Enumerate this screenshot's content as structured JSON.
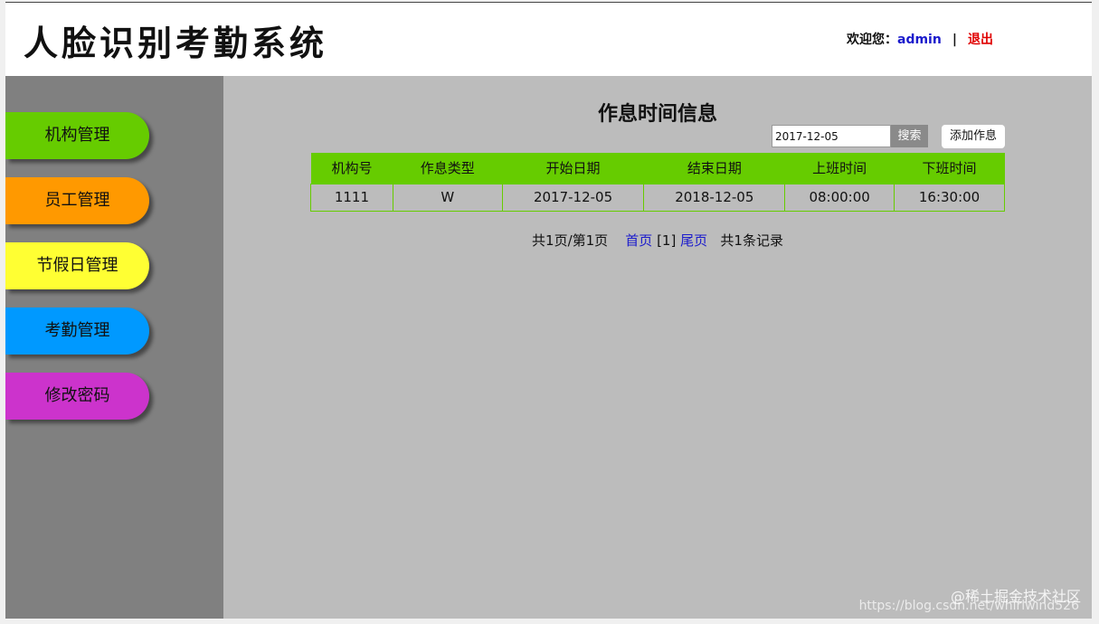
{
  "header": {
    "app_title": "人脸识别考勤系统",
    "welcome_text": "欢迎您：",
    "username": "admin",
    "separator": "|",
    "logout_label": "退出"
  },
  "sidebar": {
    "items": [
      {
        "label": "机构管理",
        "color": "#66cc00"
      },
      {
        "label": "员工管理",
        "color": "#ff9900"
      },
      {
        "label": "节假日管理",
        "color": "#ffff33"
      },
      {
        "label": "考勤管理",
        "color": "#0099ff"
      },
      {
        "label": "修改密码",
        "color": "#cc33cc"
      }
    ]
  },
  "main": {
    "title": "作息时间信息",
    "search": {
      "value": "2017-12-05",
      "button_label": "搜索"
    },
    "add_button_label": "添加作息",
    "table": {
      "columns": [
        "机构号",
        "作息类型",
        "开始日期",
        "结束日期",
        "上班时间",
        "下班时间"
      ],
      "rows": [
        [
          "1111",
          "W",
          "2017-12-05",
          "2018-12-05",
          "08:00:00",
          "16:30:00"
        ]
      ]
    },
    "pager": {
      "page_info": "共1页/第1页",
      "first_label": "首页",
      "current": "[1]",
      "last_label": "尾页",
      "total": "共1条记录"
    }
  },
  "watermark": {
    "line1": "@稀土掘金技术社区",
    "line2": "https://blog.csdn.net/whirlwind526"
  },
  "colors": {
    "table_header": "#66cc00",
    "sidebar_bg": "#808080",
    "main_bg": "#bcbcbc",
    "link": "#1a1acc",
    "logout": "#e00000"
  }
}
